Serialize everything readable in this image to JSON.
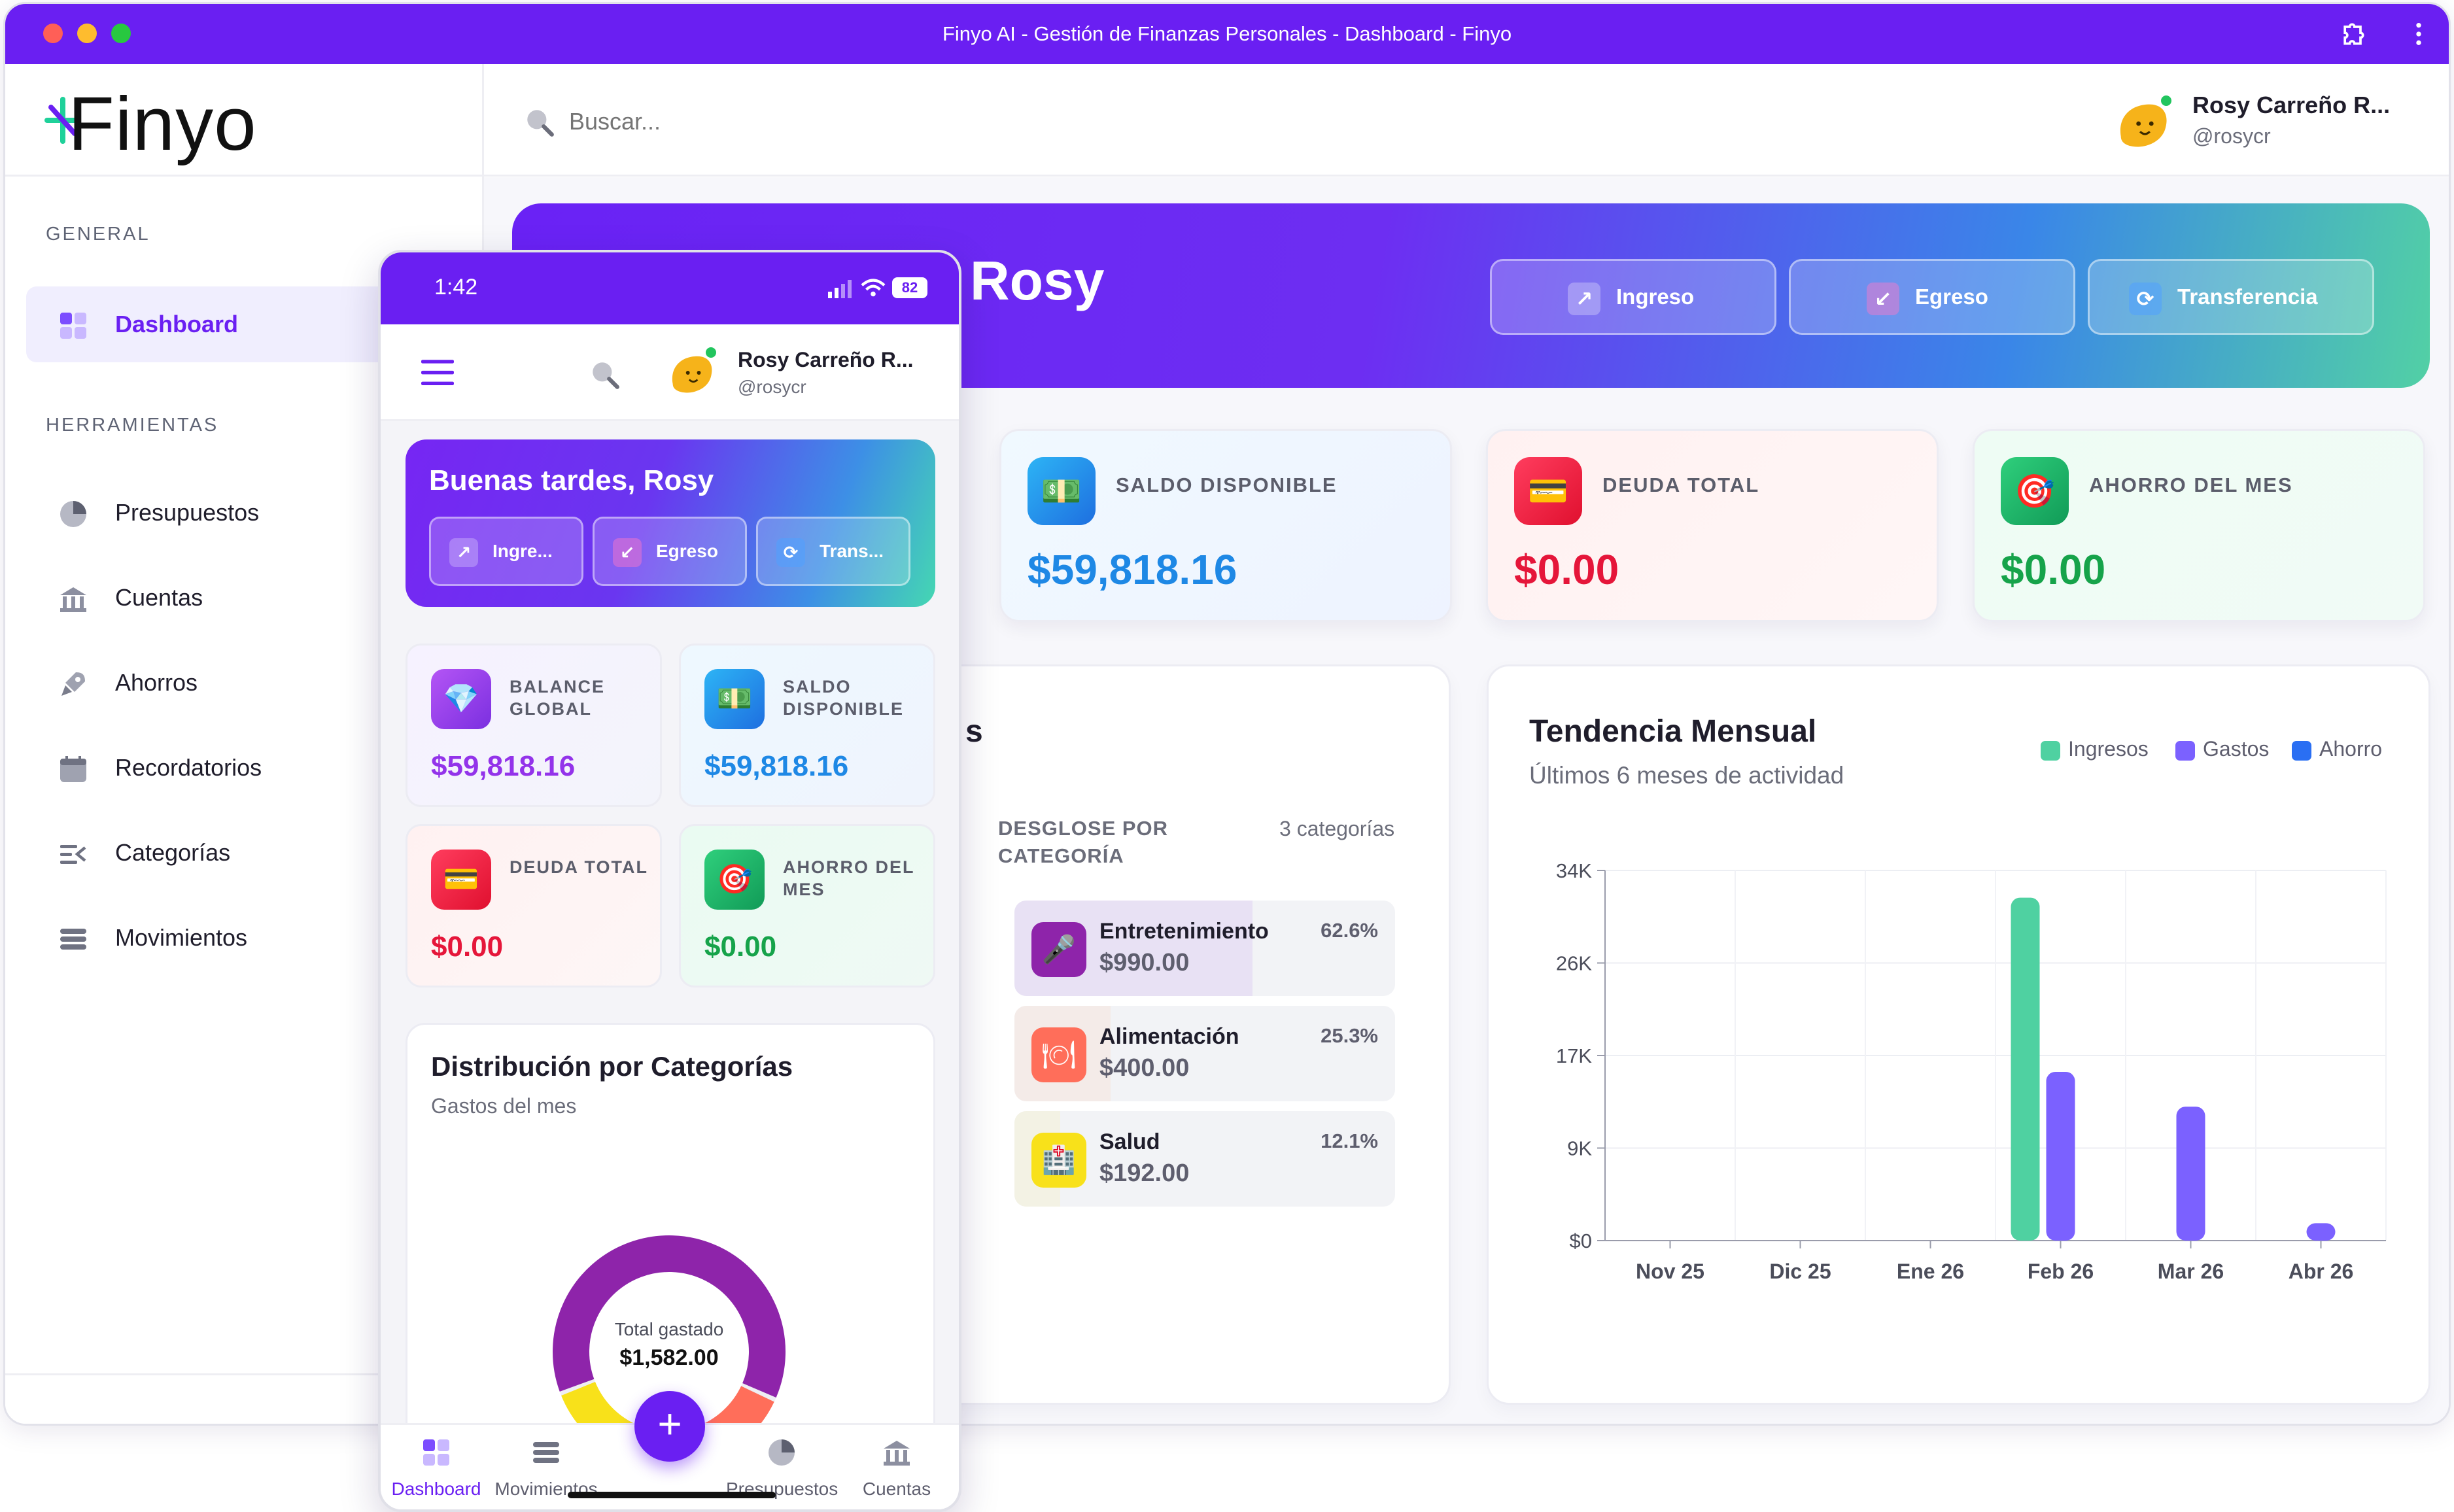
{
  "window": {
    "title": "Finyo AI - Gestión de Finanzas Personales - Dashboard - Finyo"
  },
  "brand": {
    "name": "Finyo",
    "accent": "#6a1ff2"
  },
  "search": {
    "placeholder": "Buscar..."
  },
  "user": {
    "name": "Rosy Carreño R...",
    "handle": "@rosycr"
  },
  "sidebar": {
    "section_general": "GENERAL",
    "section_tools": "HERRAMIENTAS",
    "items": [
      {
        "label": "Dashboard",
        "icon": "dashboard-grid-icon"
      },
      {
        "label": "Presupuestos",
        "icon": "pie-chart-icon"
      },
      {
        "label": "Cuentas",
        "icon": "bank-icon"
      },
      {
        "label": "Ahorros",
        "icon": "rocket-icon"
      },
      {
        "label": "Recordatorios",
        "icon": "calendar-icon"
      },
      {
        "label": "Categorías",
        "icon": "categories-icon"
      },
      {
        "label": "Movimientos",
        "icon": "list-icon"
      }
    ]
  },
  "hero": {
    "greeting_visible": "Rosy",
    "buttons": [
      {
        "label": "Ingreso",
        "icon": "arrow-up-right-icon"
      },
      {
        "label": "Egreso",
        "icon": "arrow-down-left-icon"
      },
      {
        "label": "Transferencia",
        "icon": "refresh-icon"
      }
    ]
  },
  "stats": [
    {
      "title": "SALDO DISPONIBLE",
      "value": "$59,818.16",
      "color": "#1e88e5",
      "icon": "money-icon"
    },
    {
      "title": "DEUDA TOTAL",
      "value": "$0.00",
      "color": "#e5163a",
      "icon": "credit-card-icon"
    },
    {
      "title": "AHORRO DEL MES",
      "value": "$0.00",
      "color": "#16a34a",
      "icon": "target-icon"
    }
  ],
  "breakdown": {
    "title_fragment": "s",
    "heading": "DESGLOSE POR CATEGORÍA",
    "count": "3 categorías",
    "items": [
      {
        "name": "Entretenimiento",
        "amount": "$990.00",
        "percent": "62.6%",
        "share": 0.626,
        "icon": "microphone-icon",
        "color": "#8e24aa"
      },
      {
        "name": "Alimentación",
        "amount": "$400.00",
        "percent": "25.3%",
        "share": 0.253,
        "icon": "plate-icon",
        "color": "#ff6e5a"
      },
      {
        "name": "Salud",
        "amount": "$192.00",
        "percent": "12.1%",
        "share": 0.121,
        "icon": "hospital-icon",
        "color": "#f8e11a"
      }
    ]
  },
  "trend": {
    "title": "Tendencia Mensual",
    "subtitle": "Últimos 6 meses de actividad"
  },
  "chart_data": {
    "type": "bar",
    "categories": [
      "Nov 25",
      "Dic 25",
      "Ene 26",
      "Feb 26",
      "Mar 26",
      "Abr 26"
    ],
    "series": [
      {
        "name": "Ingresos",
        "color": "#4fd1a1",
        "values": [
          0,
          0,
          0,
          31500,
          0,
          0
        ]
      },
      {
        "name": "Gastos",
        "color": "#7b61ff",
        "values": [
          0,
          0,
          0,
          15500,
          12300,
          1600
        ]
      },
      {
        "name": "Ahorro",
        "color": "#2a6ff3",
        "values": [
          0,
          0,
          0,
          0,
          0,
          0
        ]
      }
    ],
    "yticks": [
      "$0",
      "9K",
      "17K",
      "26K",
      "34K"
    ],
    "ylim": [
      0,
      34000
    ],
    "legend": "top-right",
    "grid": true
  },
  "phone": {
    "time": "1:42",
    "battery": "82",
    "greeting": "Buenas tardes, Rosy",
    "buttons": [
      {
        "label": "Ingre...",
        "icon": "arrow-up-right-icon"
      },
      {
        "label": "Egreso",
        "icon": "arrow-down-left-icon"
      },
      {
        "label": "Trans...",
        "icon": "refresh-icon"
      }
    ],
    "cards": [
      {
        "title": "BALANCE GLOBAL",
        "value": "$59,818.16",
        "color": "#9333ea",
        "icon": "diamond-icon"
      },
      {
        "title": "SALDO DISPONIBLE",
        "value": "$59,818.16",
        "color": "#1e88e5",
        "icon": "money-icon"
      },
      {
        "title": "DEUDA TOTAL",
        "value": "$0.00",
        "color": "#e5163a",
        "icon": "credit-card-icon"
      },
      {
        "title": "AHORRO DEL MES",
        "value": "$0.00",
        "color": "#16a34a",
        "icon": "target-icon"
      }
    ],
    "distribution": {
      "title": "Distribución por Categorías",
      "subtitle": "Gastos del mes",
      "center_label": "Total gastado",
      "center_value": "$1,582.00"
    },
    "nav": [
      {
        "label": "Dashboard",
        "icon": "dashboard-grid-icon"
      },
      {
        "label": "Movimientos",
        "icon": "list-icon"
      },
      {
        "label": "Presupuestos",
        "icon": "pie-chart-icon"
      },
      {
        "label": "Cuentas",
        "icon": "bank-icon"
      }
    ],
    "fab_label": "+"
  }
}
